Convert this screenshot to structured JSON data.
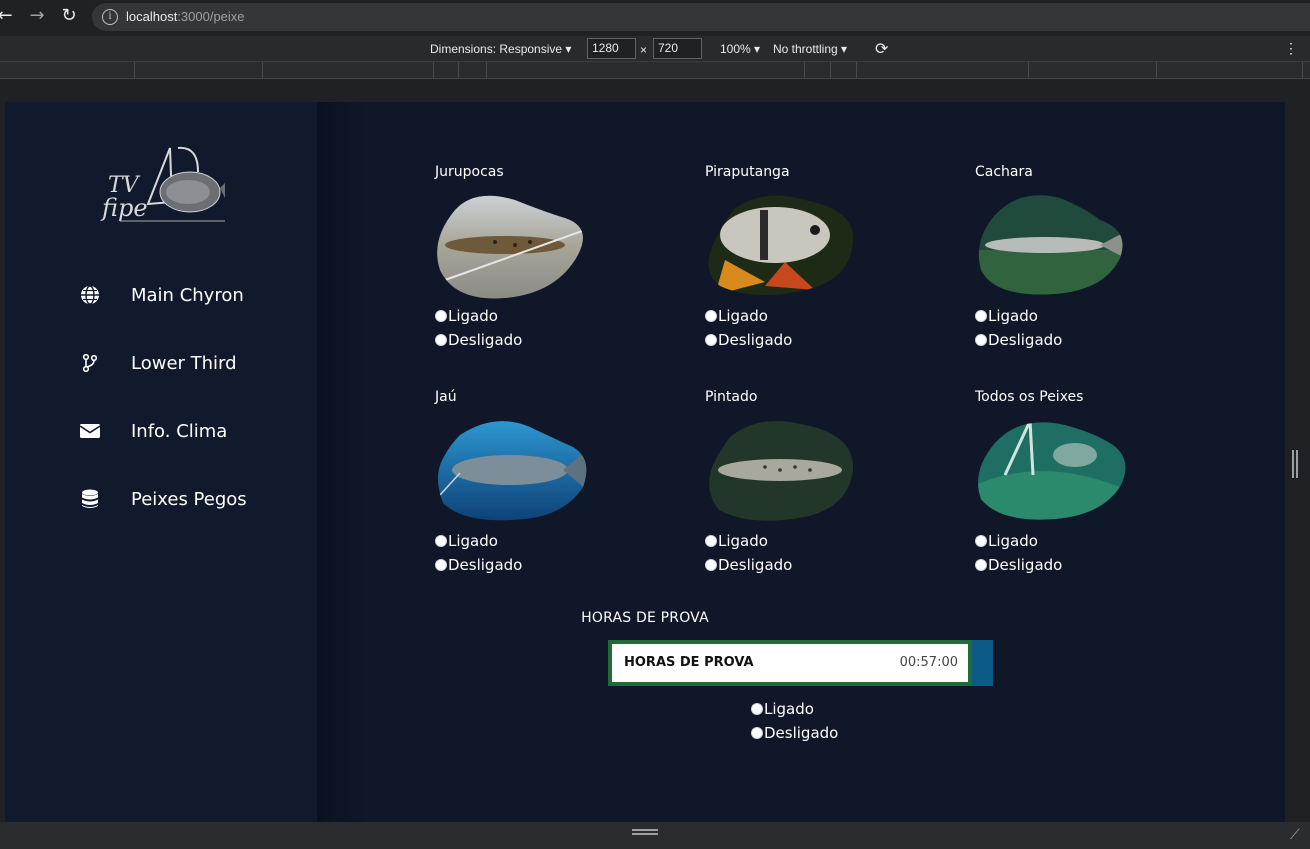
{
  "browser": {
    "url_host": "localhost",
    "url_path": ":3000/peixe"
  },
  "devtools": {
    "dimensions_label": "Dimensions: Responsive ▾",
    "width": "1280",
    "times": "×",
    "height": "720",
    "zoom": "100% ▾",
    "throttling": "No throttling ▾"
  },
  "sidebar": {
    "logo_text": "TV fipe",
    "items": [
      {
        "label": "Main Chyron",
        "icon": "globe-icon"
      },
      {
        "label": "Lower Third",
        "icon": "branch-icon"
      },
      {
        "label": "Info. Clima",
        "icon": "envelope-icon"
      },
      {
        "label": "Peixes Pegos",
        "icon": "database-icon"
      }
    ]
  },
  "fish": [
    {
      "name": "Jurupocas",
      "on": "Ligado",
      "off": "Desligado"
    },
    {
      "name": "Piraputanga",
      "on": "Ligado",
      "off": "Desligado"
    },
    {
      "name": "Cachara",
      "on": "Ligado",
      "off": "Desligado"
    },
    {
      "name": "Jaú",
      "on": "Ligado",
      "off": "Desligado"
    },
    {
      "name": "Pintado",
      "on": "Ligado",
      "off": "Desligado"
    },
    {
      "name": "Todos os Peixes",
      "on": "Ligado",
      "off": "Desligado"
    }
  ],
  "horas": {
    "title": "HORAS DE PROVA",
    "chyron_label": "HORAS DE PROVA",
    "time": "00:57:00",
    "on": "Ligado",
    "off": "Desligado"
  }
}
